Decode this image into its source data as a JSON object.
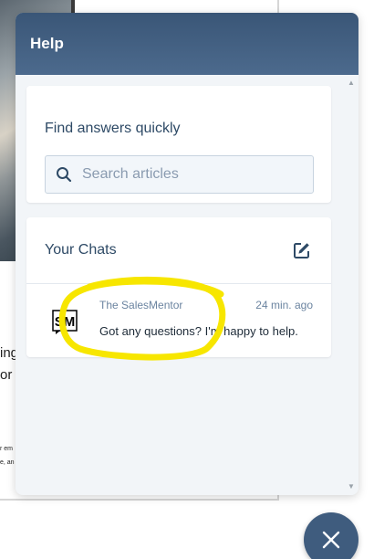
{
  "widget": {
    "title": "Help"
  },
  "search": {
    "heading": "Find answers quickly",
    "placeholder": "Search articles"
  },
  "chats": {
    "heading": "Your Chats",
    "items": [
      {
        "avatar_text": "SM",
        "sender": "The SalesMentor",
        "time": "24 min. ago",
        "message": "Got any questions? I'm happy to help."
      }
    ]
  },
  "colors": {
    "header": "#4a6789",
    "panel_bg": "#f2f5f8",
    "highlight": "#f7e600",
    "fab": "#3f5c7e"
  },
  "icons": {
    "search": "search-icon",
    "compose": "edit-icon",
    "close": "close-icon"
  }
}
